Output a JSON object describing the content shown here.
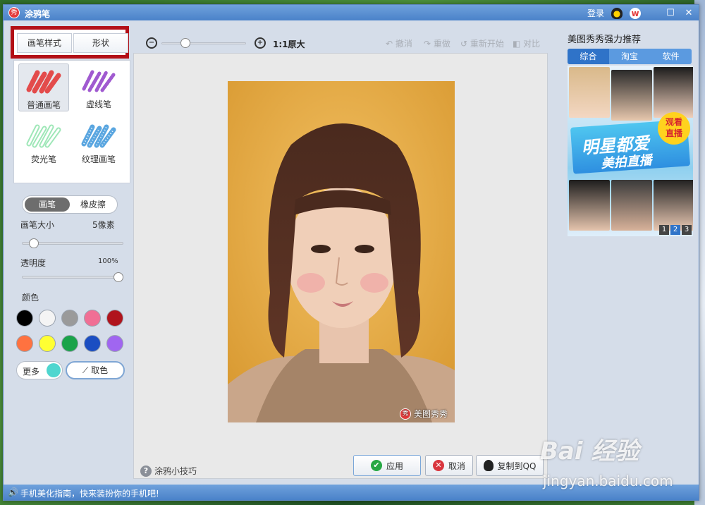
{
  "window": {
    "title": "涂鸦笔",
    "logo_glyph": "秀",
    "login_label": "登录",
    "minimize": "—",
    "maximize": "☐",
    "close": "✕"
  },
  "left": {
    "tabs": [
      "画笔样式",
      "形状"
    ],
    "brushes": [
      {
        "label": "普通画笔",
        "color": "#e34b4b",
        "selected": true
      },
      {
        "label": "虚线笔",
        "color": "#a05ad0"
      },
      {
        "label": "荧光笔",
        "color": "#9fe7b8"
      },
      {
        "label": "纹理画笔",
        "color": "#5aa6e0"
      }
    ],
    "mode_on": "画笔",
    "mode_off": "橡皮擦",
    "size_label": "画笔大小",
    "size_value": "5像素",
    "size_fraction": 0.08,
    "opacity_label": "透明度",
    "opacity_value": "100%",
    "opacity_fraction": 1.0,
    "color_label": "颜色",
    "colors": [
      "#000000",
      "#f4f4f4",
      "#9a9a9a",
      "#f06f95",
      "#b0141d",
      "#ff7240",
      "#ffff33",
      "#1aa34a",
      "#1b4ec2",
      "#a066f0"
    ],
    "more_label": "更多",
    "more_color": "#4fd6cf",
    "pick_label": "取色"
  },
  "toolbar": {
    "zoom_out": "−",
    "zoom_in": "+",
    "zoom_level_fraction": 0.25,
    "zoom_label": "1:1原大",
    "undo": "撤消",
    "redo": "重做",
    "restart": "重新开始",
    "compare": "对比"
  },
  "canvas": {
    "watermark": "美图秀秀"
  },
  "footer": {
    "tips": "涂鸦小技巧",
    "apply": "应用",
    "cancel": "取消",
    "copy": "复制到QQ"
  },
  "right": {
    "title": "美图秀秀强力推荐",
    "tabs": [
      "综合",
      "淘宝",
      "软件"
    ],
    "ad_line1": "明星都爱",
    "ad_line2": "美拍直播",
    "ad_badge_1": "观看",
    "ad_badge_2": "直播",
    "pages": [
      "1",
      "2",
      "3"
    ]
  },
  "status": {
    "icon": "🔊",
    "text": "手机美化指南，快来装扮你的手机吧!"
  },
  "overlay": {
    "baidu": "Bai 经验",
    "site": "jingyan.baidu.com"
  }
}
